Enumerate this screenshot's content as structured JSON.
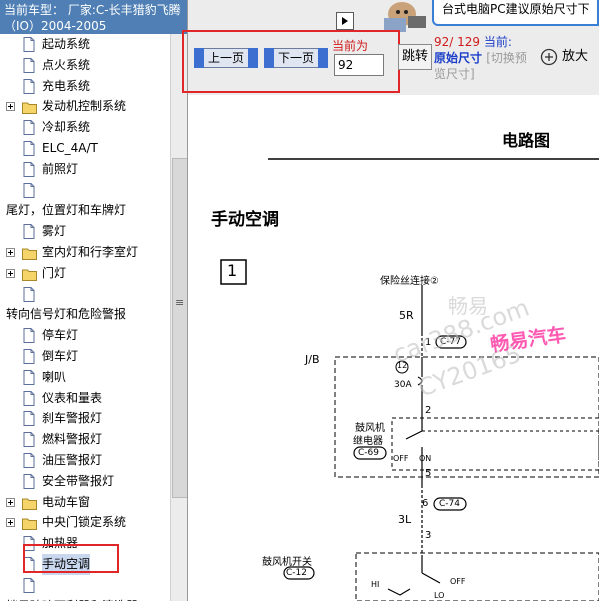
{
  "car_header": {
    "text": "当前车型： 厂家:C-长丰猎豹飞腾（IO）2004-2005"
  },
  "tree": [
    {
      "type": "doc",
      "label": "起动系统"
    },
    {
      "type": "doc",
      "label": "点火系统"
    },
    {
      "type": "doc",
      "label": "充电系统"
    },
    {
      "type": "folder",
      "label": "发动机控制系统"
    },
    {
      "type": "doc",
      "label": "冷却系统"
    },
    {
      "type": "doc",
      "label": "ELC_4A/T"
    },
    {
      "type": "doc",
      "label": "前照灯"
    },
    {
      "type": "doc",
      "label": ""
    },
    {
      "type": "text",
      "label": "尾灯，位置灯和车牌灯"
    },
    {
      "type": "doc",
      "label": "雾灯"
    },
    {
      "type": "folder",
      "label": "室内灯和行李室灯"
    },
    {
      "type": "folder",
      "label": "门灯"
    },
    {
      "type": "doc",
      "label": ""
    },
    {
      "type": "text",
      "label": "转向信号灯和危险警报"
    },
    {
      "type": "doc",
      "label": "停车灯"
    },
    {
      "type": "doc",
      "label": "倒车灯"
    },
    {
      "type": "doc",
      "label": "喇叭"
    },
    {
      "type": "doc",
      "label": "仪表和量表"
    },
    {
      "type": "doc",
      "label": "刹车警报灯"
    },
    {
      "type": "doc",
      "label": "燃料警报灯"
    },
    {
      "type": "doc",
      "label": "油压警报灯"
    },
    {
      "type": "doc",
      "label": "安全带警报灯"
    },
    {
      "type": "folder",
      "label": "电动车窗"
    },
    {
      "type": "folder",
      "label": "中央门锁定系统"
    },
    {
      "type": "doc",
      "label": "加热器"
    },
    {
      "type": "doc",
      "label": "手动空调",
      "selected": true
    },
    {
      "type": "doc",
      "label": ""
    },
    {
      "type": "text",
      "label": "挡风玻璃雨刮器和清洗器"
    }
  ],
  "tree_scroll_grip": "≡",
  "toolbar": {
    "prev_page_label": "上一页",
    "next_page_label": "下一页",
    "current_label": "当前为",
    "page_value": "92",
    "jump_label": "跳转",
    "page_count": "92/ 129",
    "current_prefix": "当前:",
    "view_mode": "原始尺寸",
    "switch_preview": "[切换预览尺寸]",
    "zoom_label": "放大",
    "ad_text": "台式电脑PC建议原始尺寸下"
  },
  "diagram": {
    "title": "电路图",
    "section_title": "手动空调",
    "box_number": "1",
    "fuse_label": "保险丝连接②",
    "wire_5r": "5R",
    "connector_c77": "C-77",
    "pin_1": "1",
    "jb_label": "J/B",
    "fuse_no": "12",
    "fuse_amp": "30A",
    "pin_2": "2",
    "relay_label_1": "鼓风机",
    "relay_label_2": "继电器",
    "connector_c69": "C-69",
    "off_label": "OFF",
    "on_label": "ON",
    "pin_5": "5",
    "pin_6": "6",
    "connector_c74": "C-74",
    "wire_3l": "3L",
    "pin_3": "3",
    "switch_label": "鼓风机开关",
    "connector_c12": "C-12",
    "hi_label": "HI",
    "off_label2": "OFF",
    "lo_label": "LO"
  },
  "watermark": {
    "line1": "畅易",
    "line2": "car388.com",
    "line3": "CY20165",
    "brand": "畅易汽车"
  },
  "colors": {
    "header_bg": "#4f7fb4",
    "highlight_border": "#e02626",
    "red_text": "#d01a1a",
    "blue_text": "#1b3ec9",
    "watermark_brand": "#ff3ea5"
  }
}
